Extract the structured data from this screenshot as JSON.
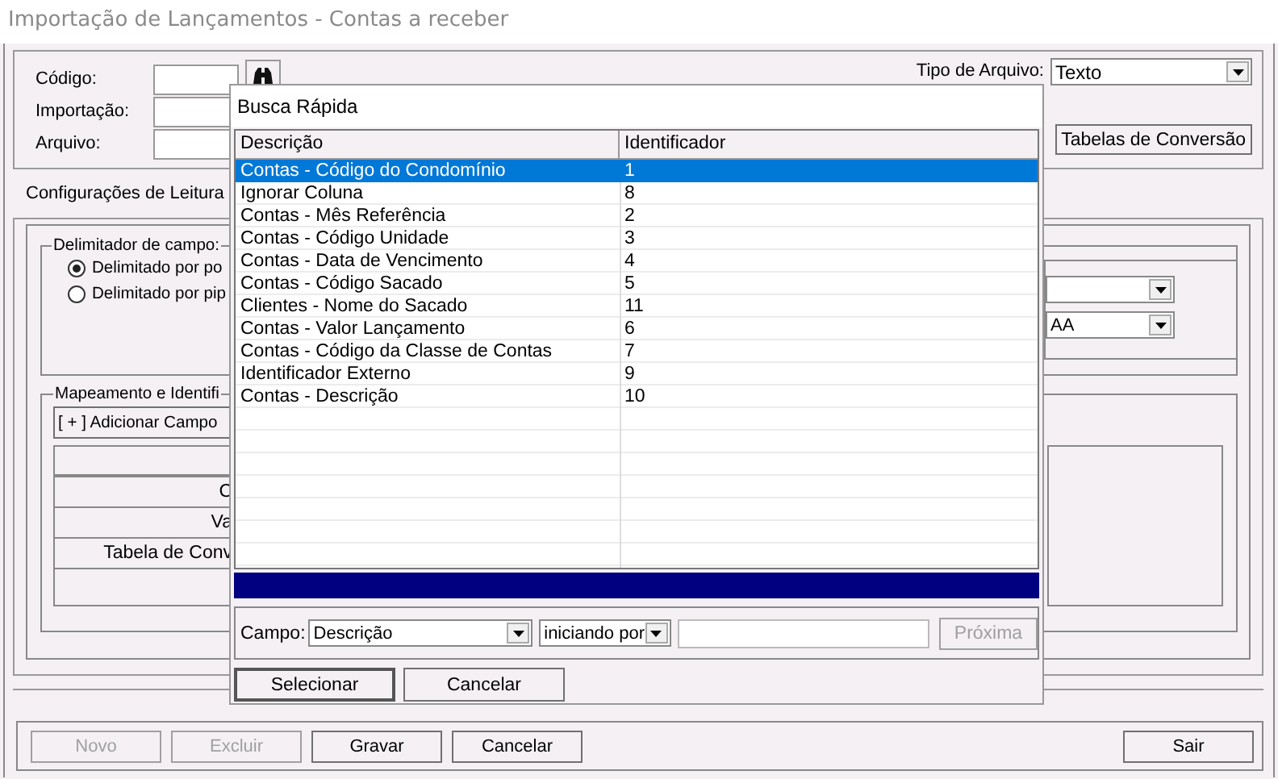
{
  "window": {
    "title": "Importação de Lançamentos - Contas a receber"
  },
  "header": {
    "fields": [
      {
        "label": "Código:"
      },
      {
        "label": "Importação:"
      },
      {
        "label": "Arquivo:"
      }
    ],
    "file_type": {
      "label": "Tipo de Arquivo:",
      "value": "Texto"
    },
    "conversion_button": "Tabelas de Conversão"
  },
  "tabs": [
    {
      "label": "Configurações de Leitura",
      "selected": true
    }
  ],
  "delimiter_group": {
    "title": "Delimitador de campo:",
    "options": [
      {
        "label": "Delimitado por po",
        "selected": true
      },
      {
        "label": "Delimitado por pip",
        "selected": false
      }
    ],
    "date_format": "AA"
  },
  "mapping_group": {
    "title": "Mapeamento e Identifi",
    "add_button": "[ + ] Adicionar Campo",
    "rows": [
      "C",
      "Va",
      "Tabela de Conv"
    ]
  },
  "buttons": [
    {
      "label": "Novo",
      "disabled": true
    },
    {
      "label": "Excluir",
      "disabled": true
    },
    {
      "label": "Gravar",
      "disabled": false
    },
    {
      "label": "Cancelar",
      "disabled": false
    }
  ],
  "exit_button": {
    "label": "Sair",
    "disabled": false
  },
  "dialog": {
    "title": "Busca Rápida",
    "columns": [
      "Descrição",
      "Identificador"
    ],
    "rows": [
      {
        "description": "Contas - Código do Condomínio",
        "id": "1",
        "selected": true
      },
      {
        "description": "Ignorar Coluna",
        "id": "8",
        "selected": false
      },
      {
        "description": "Contas - Mês Referência",
        "id": "2",
        "selected": false
      },
      {
        "description": "Contas - Código Unidade",
        "id": "3",
        "selected": false
      },
      {
        "description": "Contas - Data de Vencimento",
        "id": "4",
        "selected": false
      },
      {
        "description": "Contas - Código Sacado",
        "id": "5",
        "selected": false
      },
      {
        "description": "Clientes - Nome do Sacado",
        "id": "11",
        "selected": false
      },
      {
        "description": "Contas - Valor Lançamento",
        "id": "6",
        "selected": false
      },
      {
        "description": "Contas - Código da Classe de Contas",
        "id": "7",
        "selected": false
      },
      {
        "description": "Identificador Externo",
        "id": "9",
        "selected": false
      },
      {
        "description": "Contas - Descrição",
        "id": "10",
        "selected": false
      }
    ],
    "search": {
      "label": "Campo:",
      "field": "Descrição",
      "mode": "iniciando por",
      "next_button": {
        "label": "Próxima",
        "disabled": true
      }
    },
    "buttons": [
      {
        "label": "Selecionar",
        "default": true
      },
      {
        "label": "Cancelar",
        "default": false
      }
    ]
  }
}
